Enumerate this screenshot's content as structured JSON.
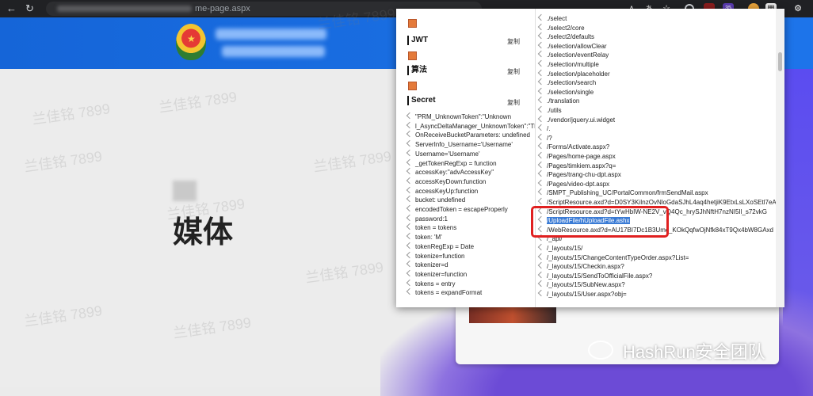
{
  "browser": {
    "url_path": "me-page.aspx",
    "icons": [
      "back-icon",
      "reload-icon",
      "font-size-icon",
      "translate-icon",
      "star-icon",
      "ext-circle-icon",
      "ext-record-icon",
      "ext-badge-icon",
      "ext-orange-icon",
      "ext-puzzle-icon",
      "profile-icon"
    ],
    "badge_count": "35"
  },
  "page": {
    "heading": "媒体",
    "watermark": "兰佳铭 7899",
    "brand": "HashRun安全团队"
  },
  "panel": {
    "sections": [
      {
        "title": "JWT",
        "copy": "复制"
      },
      {
        "title": "算法",
        "copy": "复制"
      },
      {
        "title": "Secret",
        "copy": "复制"
      }
    ],
    "secret_items": [
      "\"PRM_UnknownToken\":\"Unknown",
      "l_AsyncDeltaManager_UnknownToken\":\"The",
      "OnReceiveBucketParameters: undefined",
      "ServerInfo_Username='Username'",
      "Username='Username'",
      "_getTokenRegExp = function",
      "accessKey:\"advAccessKey\"",
      "accessKeyDown:function",
      "accessKeyUp:function",
      "bucket: undefined",
      "encodedToken = escapeProperly",
      "password:1",
      "token = tokens",
      "token:    'M'",
      "tokenRegExp = Date",
      "tokenize=function",
      "tokenizer=d",
      "tokenizer=function",
      "tokens = entry",
      "tokens = expandFormat"
    ],
    "paths": [
      "./select",
      "./select2/core",
      "./select2/defaults",
      "./selection/allowClear",
      "./selection/eventRelay",
      "./selection/multiple",
      "./selection/placeholder",
      "./selection/search",
      "./selection/single",
      "./translation",
      "./utils",
      "./vendor/jquery.ui.widget",
      "/.",
      "/?",
      "/Forms/Activate.aspx?",
      "/Pages/home-page.aspx",
      "/Pages/timkiem.aspx?q=",
      "/Pages/trang-chu-dpt.aspx",
      "/Pages/video-dpt.aspx",
      "/SMPT_Publishing_UC/PortalCommon/frmSendMail.aspx",
      "/ScriptResource.axd?d=D0SY3KiInzOvNloGdaSJhL4aq4hetjiK9EtxLsLXoSEtl7eA",
      "/ScriptResource.axd?d=tYwHbIW-NE2V_vQ4Qc_hrySJhNftH7nzNI5Il_s72vkG",
      "/UploadFile/hUploadFile.ashx",
      "/WebResource.axd?d=AU17BI7Dc1B3Umc_KOkQqfwOjNfk84xT9Qx4bW8GAxd",
      "/_api/",
      "/_layouts/15/",
      "/_layouts/15/ChangeContentTypeOrder.aspx?List=",
      "/_layouts/15/Checkin.aspx?",
      "/_layouts/15/SendToOfficialFile.aspx?",
      "/_layouts/15/SubNew.aspx?",
      "/_layouts/15/User.aspx?obj="
    ],
    "highlighted_path_index": 22
  }
}
